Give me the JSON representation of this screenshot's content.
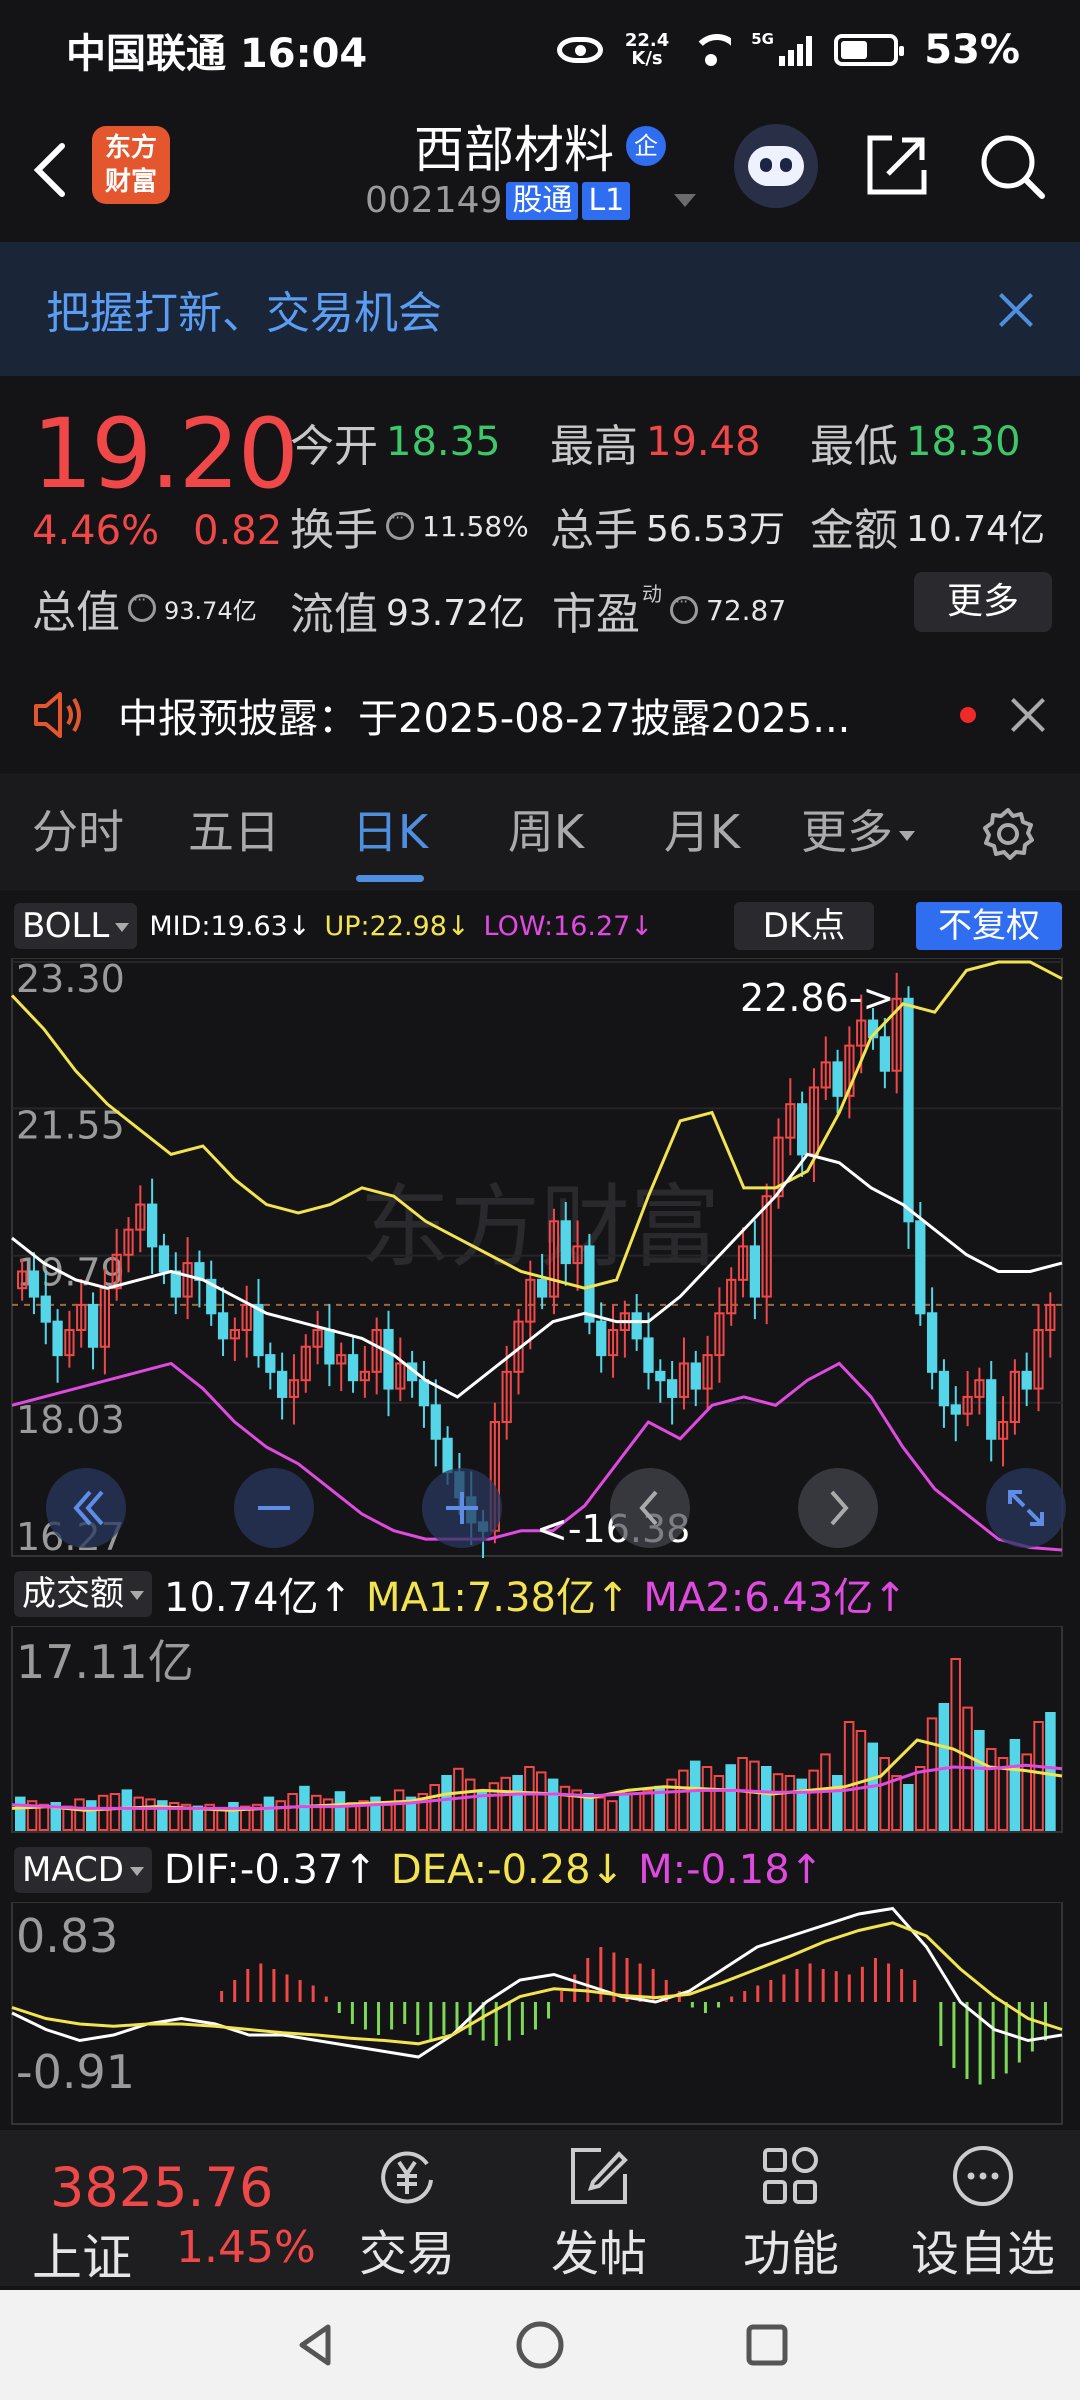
{
  "status": {
    "carrier_time": "中国联通 16:04",
    "net_speed_top": "22.4",
    "net_speed_unit": "K/s",
    "network": "5G",
    "battery": "53%"
  },
  "header": {
    "brand": "东方\n财富",
    "stock_name": "西部材料",
    "corp_tag": "企",
    "code": "002149",
    "tag_hk": "股通",
    "tag_level": "L1"
  },
  "banner": {
    "text": "把握打新、交易机会"
  },
  "quote": {
    "price": "19.20",
    "change_pct": "4.46%",
    "change_val": "0.82",
    "open_label": "今开",
    "open": "18.35",
    "high_label": "最高",
    "high": "19.48",
    "low_label": "最低",
    "low": "18.30",
    "turnover_label": "换手",
    "turnover": "11.58%",
    "volume_label": "总手",
    "volume": "56.53万",
    "amount_label": "金额",
    "amount": "10.74亿",
    "mcap_label": "总值",
    "mcap": "93.74亿",
    "float_label": "流值",
    "float": "93.72亿",
    "pe_label": "市盈",
    "pe_sup": "动",
    "pe": "72.87",
    "more_label": "更多"
  },
  "notice": {
    "text": "中报预披露：于2025-08-27披露2025..."
  },
  "tabs": [
    {
      "label": "分时"
    },
    {
      "label": "五日"
    },
    {
      "label": "日K"
    },
    {
      "label": "周K"
    },
    {
      "label": "月K"
    },
    {
      "label": "更多"
    }
  ],
  "kline": {
    "indicator": "BOLL",
    "mid": "MID:19.63↓",
    "up": "UP:22.98↓",
    "low": "LOW:16.27↓",
    "dk_label": "DK点",
    "fq_label": "不复权",
    "axis": [
      "23.30",
      "21.55",
      "19.79",
      "18.03",
      "16.27"
    ],
    "high_mark": "22.86->",
    "low_mark": "<-16.38",
    "watermark": "东方财富"
  },
  "amount_panel": {
    "indicator": "成交额",
    "value": "10.74亿↑",
    "ma1": "MA1:7.38亿↑",
    "ma2": "MA2:6.43亿↑",
    "axis_top": "17.11亿"
  },
  "macd_panel": {
    "indicator": "MACD",
    "dif": "DIF:-0.37↑",
    "dea": "DEA:-0.28↓",
    "m": "M:-0.18↑",
    "axis_top": "0.83",
    "axis_bottom": "-0.91"
  },
  "colors": {
    "up": "#f04848",
    "down": "#55d6e8",
    "boll_up": "#f2e450",
    "boll_low": "#e04ae0",
    "mid": "#ffffff"
  },
  "bottom_nav": {
    "index_value": "3825.76",
    "index_name": "上证",
    "index_change": "1.45%",
    "items": [
      {
        "label": "交易",
        "icon": "yen-cycle-icon"
      },
      {
        "label": "发帖",
        "icon": "edit-icon"
      },
      {
        "label": "功能",
        "icon": "grid-icon"
      },
      {
        "label": "设自选",
        "icon": "more-icon"
      }
    ]
  }
}
